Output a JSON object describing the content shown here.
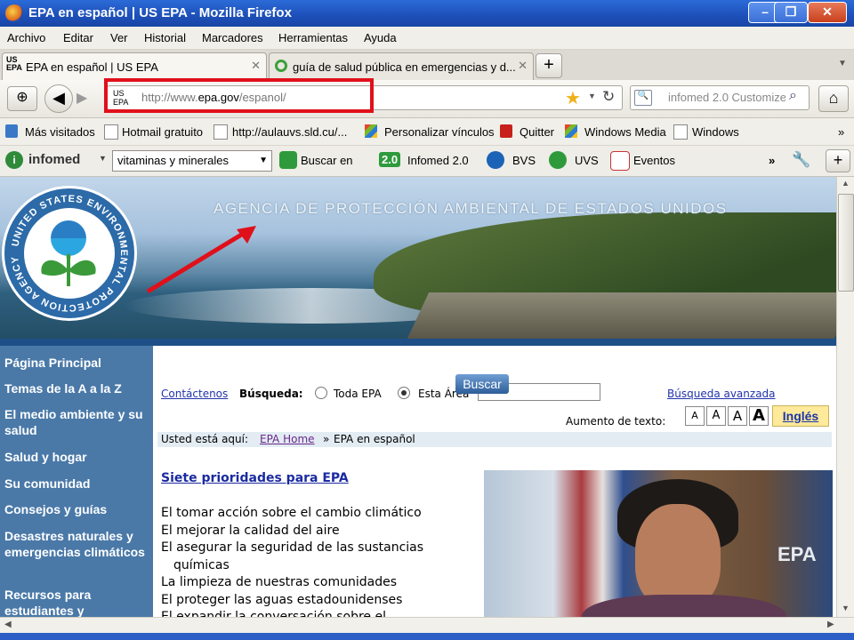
{
  "window": {
    "title": "EPA en español | US EPA - Mozilla Firefox"
  },
  "menu": [
    "Archivo",
    "Editar",
    "Ver",
    "Historial",
    "Marcadores",
    "Herramientas",
    "Ayuda"
  ],
  "tabs": [
    {
      "favicon": "US EPA",
      "label": "EPA en español | US EPA",
      "close": "✕"
    },
    {
      "label": "guía de salud pública en emergencias y d...",
      "close": "✕"
    }
  ],
  "new_tab": "+",
  "nav": {
    "site_badge": "US EPA",
    "url_prefix": "http://www.",
    "url_domain": "epa.gov",
    "url_suffix": "/espanol/",
    "search_placeholder": "infomed 2.0 Customize"
  },
  "bookmarks": [
    "Más visitados",
    "Hotmail gratuito",
    "http://aulauvs.sld.cu/...",
    "Personalizar vínculos",
    "Quitter",
    "Windows Media",
    "Windows",
    "»"
  ],
  "infomed_toolbar": {
    "brand": "infomed",
    "select_value": "vitaminas y minerales",
    "items": [
      "Buscar en",
      "Infomed 2.0",
      "BVS",
      "UVS",
      "Eventos"
    ],
    "badge": "2.0",
    "more": "»"
  },
  "page": {
    "banner_text": "AGENCIA DE PROTECCIÓN AMBIENTAL DE ESTADOS UNIDOS",
    "seal_text": "UNITED STATES ENVIRONMENTAL PROTECTION AGENCY",
    "left_nav": [
      "Página Principal",
      "Temas de la A a la Z",
      "El medio ambiente y su salud",
      "Salud y hogar",
      "Su comunidad",
      "Consejos y guías",
      "Desastres naturales y emergencias climáticos",
      "Recursos para estudiantes y"
    ],
    "search": {
      "contact": "Contáctenos",
      "label": "Búsqueda:",
      "option1": "Toda EPA",
      "option2": "Esta Área",
      "button": "Buscar",
      "advanced": "Búsqueda avanzada"
    },
    "text_size_label": "Aumento de texto:",
    "size_buttons": [
      "A",
      "A",
      "A",
      "A"
    ],
    "english": "Inglés",
    "breadcrumb": {
      "prefix": "Usted está aquí:",
      "home": "EPA Home",
      "sep": "»",
      "current": "EPA en español"
    },
    "priorities_title": "Siete prioridades para EPA",
    "priorities": [
      "El tomar acción sobre el cambio climático",
      "El mejorar la calidad del aire",
      "El asegurar la seguridad de las sustancias",
      "químicas",
      "La limpieza de nuestras comunidades",
      "El proteger las aguas estadounidenses",
      "El expandir la conversación sobre el"
    ],
    "photo_logo": "EPA"
  },
  "colors": {
    "nav_blue": "#4a79a8",
    "highlight_red": "#e0101a",
    "link": "#2233aa"
  }
}
